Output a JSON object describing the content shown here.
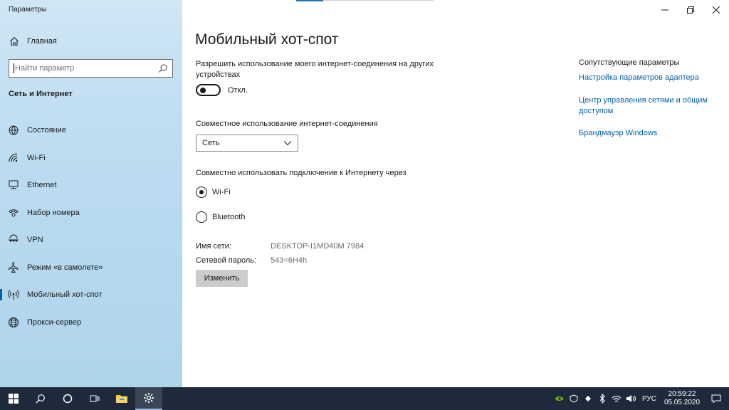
{
  "window": {
    "title": "Параметры"
  },
  "sidebar": {
    "home_label": "Главная",
    "search_placeholder": "Найти параметр",
    "section_title": "Сеть и Интернет",
    "items": [
      {
        "label": "Состояние",
        "icon": "status-icon"
      },
      {
        "label": "Wi-Fi",
        "icon": "wifi-icon"
      },
      {
        "label": "Ethernet",
        "icon": "ethernet-icon"
      },
      {
        "label": "Набор номера",
        "icon": "dialup-icon"
      },
      {
        "label": "VPN",
        "icon": "vpn-icon"
      },
      {
        "label": "Режим «в самолете»",
        "icon": "airplane-icon"
      },
      {
        "label": "Мобильный хот-спот",
        "icon": "hotspot-icon",
        "active": true
      },
      {
        "label": "Прокси-сервер",
        "icon": "globe-icon"
      }
    ]
  },
  "main": {
    "title": "Мобильный хот-спот",
    "share_description": "Разрешить использование моего интернет-соединения на других устройствах",
    "toggle_state_label": "Откл.",
    "toggle_on": false,
    "share_connection_label": "Совместное использование интернет-соединения",
    "share_connection_value": "Сеть",
    "share_via_label": "Совместно использовать подключение к Интернету через",
    "radio_options": [
      {
        "label": "Wi-Fi",
        "checked": true
      },
      {
        "label": "Bluetooth",
        "checked": false
      }
    ],
    "network_name_label": "Имя сети:",
    "network_name_value": "DESKTOP-I1MD40M 7984",
    "password_label": "Сетевой пароль:",
    "password_value": "543=6H4h",
    "change_button": "Изменить"
  },
  "related": {
    "title": "Сопутствующие параметры",
    "links": [
      "Настройка параметров адаптера",
      "Центр управления сетями и общим доступом",
      "Брандмауэр Windows"
    ]
  },
  "taskbar": {
    "language": "РУС",
    "time": "20:59:22",
    "date": "05.05.2020"
  },
  "colors": {
    "accent": "#0063b1",
    "sidebar_bg": "#bcdcf0",
    "taskbar_bg": "#1e2a3b"
  }
}
